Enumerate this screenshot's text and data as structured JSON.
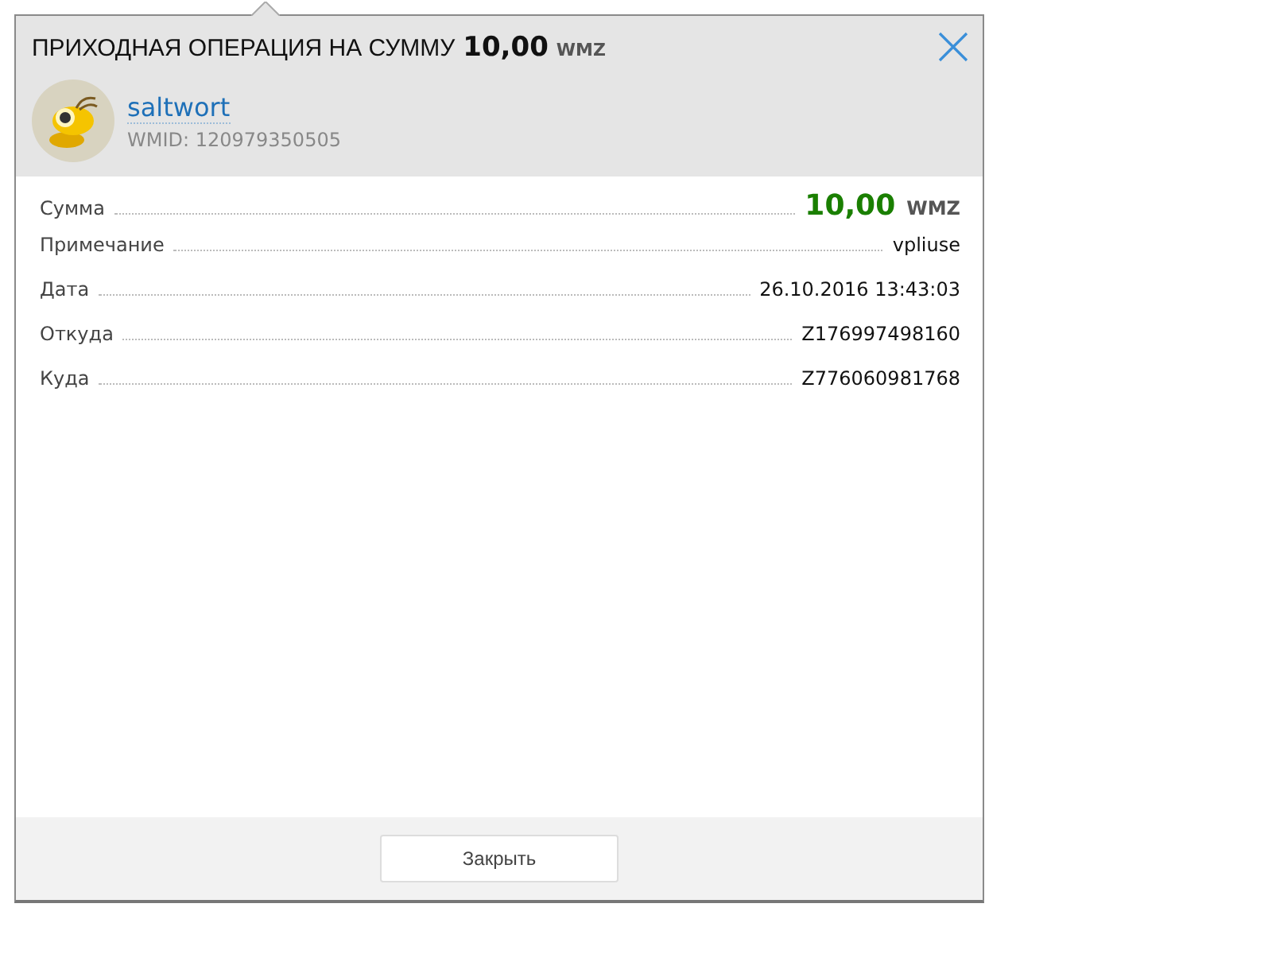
{
  "dialog": {
    "title": "ПРИХОДНАЯ ОПЕРАЦИЯ НА СУММУ",
    "title_amount": "10,00",
    "title_currency": "WMZ"
  },
  "user": {
    "name": "saltwort",
    "wmid": "WMID: 120979350505"
  },
  "details": [
    {
      "kind": "amount",
      "label": "Сумма",
      "value": "10,00",
      "currency": "WMZ"
    },
    {
      "kind": "text",
      "label": "Примечание",
      "value": "vpliuse"
    },
    {
      "kind": "text",
      "label": "Дата",
      "value": "26.10.2016 13:43:03"
    },
    {
      "kind": "text",
      "label": "Откуда",
      "value": "Z176997498160"
    },
    {
      "kind": "text",
      "label": "Куда",
      "value": "Z776060981768"
    }
  ],
  "buttons": [
    "Закрыть"
  ]
}
